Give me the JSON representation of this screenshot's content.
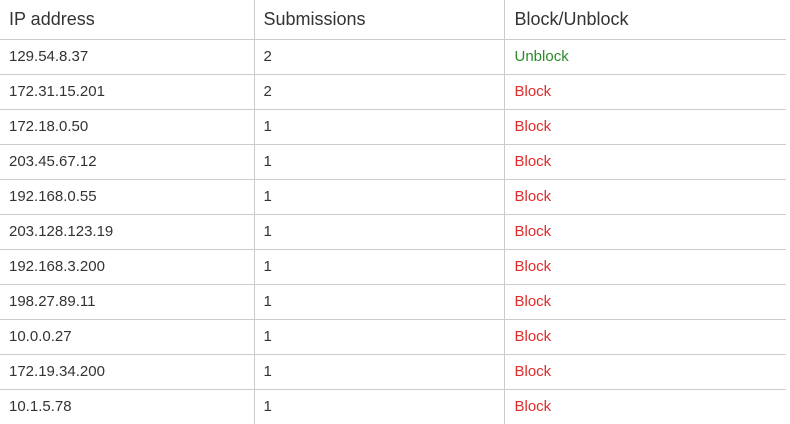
{
  "table": {
    "headers": [
      "IP address",
      "Submissions",
      "Block/Unblock"
    ],
    "rows": [
      {
        "ip": "129.54.8.37",
        "submissions": "2",
        "action": "Unblock"
      },
      {
        "ip": "172.31.15.201",
        "submissions": "2",
        "action": "Block"
      },
      {
        "ip": "172.18.0.50",
        "submissions": "1",
        "action": "Block"
      },
      {
        "ip": "203.45.67.12",
        "submissions": "1",
        "action": "Block"
      },
      {
        "ip": "192.168.0.55",
        "submissions": "1",
        "action": "Block"
      },
      {
        "ip": "203.128.123.19",
        "submissions": "1",
        "action": "Block"
      },
      {
        "ip": "192.168.3.200",
        "submissions": "1",
        "action": "Block"
      },
      {
        "ip": "198.27.89.11",
        "submissions": "1",
        "action": "Block"
      },
      {
        "ip": "10.0.0.27",
        "submissions": "1",
        "action": "Block"
      },
      {
        "ip": "172.19.34.200",
        "submissions": "1",
        "action": "Block"
      },
      {
        "ip": "10.1.5.78",
        "submissions": "1",
        "action": "Block"
      }
    ]
  },
  "colors": {
    "unblock": "#2b8a2b",
    "block": "#e02b2b",
    "border": "#cccccc",
    "text": "#333333"
  }
}
